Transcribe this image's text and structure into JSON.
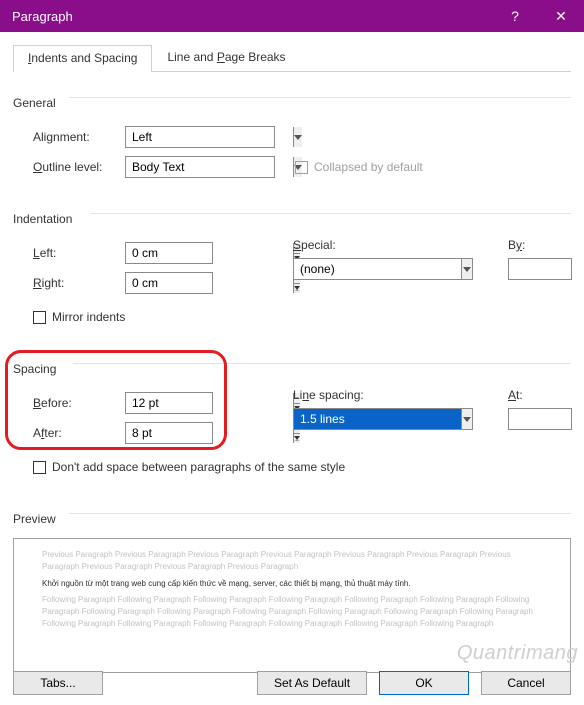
{
  "titlebar": {
    "title": "Paragraph",
    "help": "?",
    "close": "✕"
  },
  "tabs": {
    "indents": "Indents and Spacing",
    "breaks": "Line and Page Breaks"
  },
  "general": {
    "heading": "General",
    "alignment_label": "Alignment:",
    "alignment_value": "Left",
    "outline_label": "Outline level:",
    "outline_value": "Body Text",
    "collapsed_label": "Collapsed by default"
  },
  "indentation": {
    "heading": "Indentation",
    "left_label": "Left:",
    "left_value": "0 cm",
    "right_label": "Right:",
    "right_value": "0 cm",
    "special_label": "Special:",
    "special_value": "(none)",
    "by_label": "By:",
    "by_value": "",
    "mirror_label": "Mirror indents"
  },
  "spacing": {
    "heading": "Spacing",
    "before_label": "Before:",
    "before_value": "12 pt",
    "after_label": "After:",
    "after_value": "8 pt",
    "linespacing_label": "Line spacing:",
    "linespacing_value": "1.5 lines",
    "at_label": "At:",
    "at_value": "",
    "dontadd_label": "Don't add space between paragraphs of the same style"
  },
  "preview": {
    "heading": "Preview",
    "gray1": "Previous Paragraph Previous Paragraph Previous Paragraph Previous Paragraph Previous Paragraph Previous Paragraph Previous Paragraph Previous Paragraph Previous Paragraph Previous Paragraph",
    "sample": "Khởi nguồn từ một trang web cung cấp kiến thức về mạng, server, các thiết bị mạng, thủ thuật máy tính.",
    "gray2": "Following Paragraph Following Paragraph Following Paragraph Following Paragraph Following Paragraph Following Paragraph Following Paragraph Following Paragraph Following Paragraph Following Paragraph Following Paragraph Following Paragraph Following Paragraph Following Paragraph Following Paragraph Following Paragraph Following Paragraph Following Paragraph Following Paragraph"
  },
  "footer": {
    "tabs": "Tabs...",
    "set_default": "Set As Default",
    "ok": "OK",
    "cancel": "Cancel"
  },
  "watermark": "Quantrimang"
}
